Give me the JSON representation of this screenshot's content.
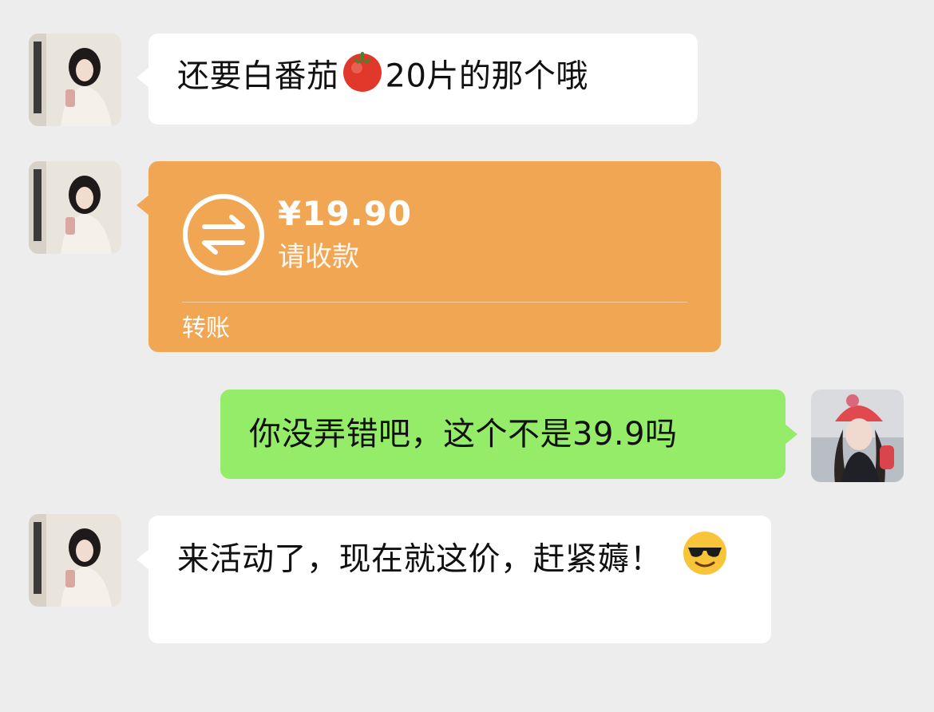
{
  "messages": [
    {
      "side": "left",
      "type": "text",
      "text_before": "还要白番茄",
      "emoji": "tomato",
      "text_after": "20片的那个哦"
    },
    {
      "side": "left",
      "type": "transfer",
      "amount": "¥19.90",
      "status": "请收款",
      "footer": "转账",
      "icon": "transfer-arrows-icon"
    },
    {
      "side": "right",
      "type": "text",
      "text": "你没弄错吧，这个不是39.9吗"
    },
    {
      "side": "left",
      "type": "text",
      "text": "来活动了，现在就这价，赶紧薅！",
      "emoji": "smiling-face-with-sunglasses"
    }
  ],
  "colors": {
    "background": "#ededed",
    "incoming_bubble": "#ffffff",
    "outgoing_bubble": "#95ec69",
    "transfer_bubble": "#f0a653"
  }
}
